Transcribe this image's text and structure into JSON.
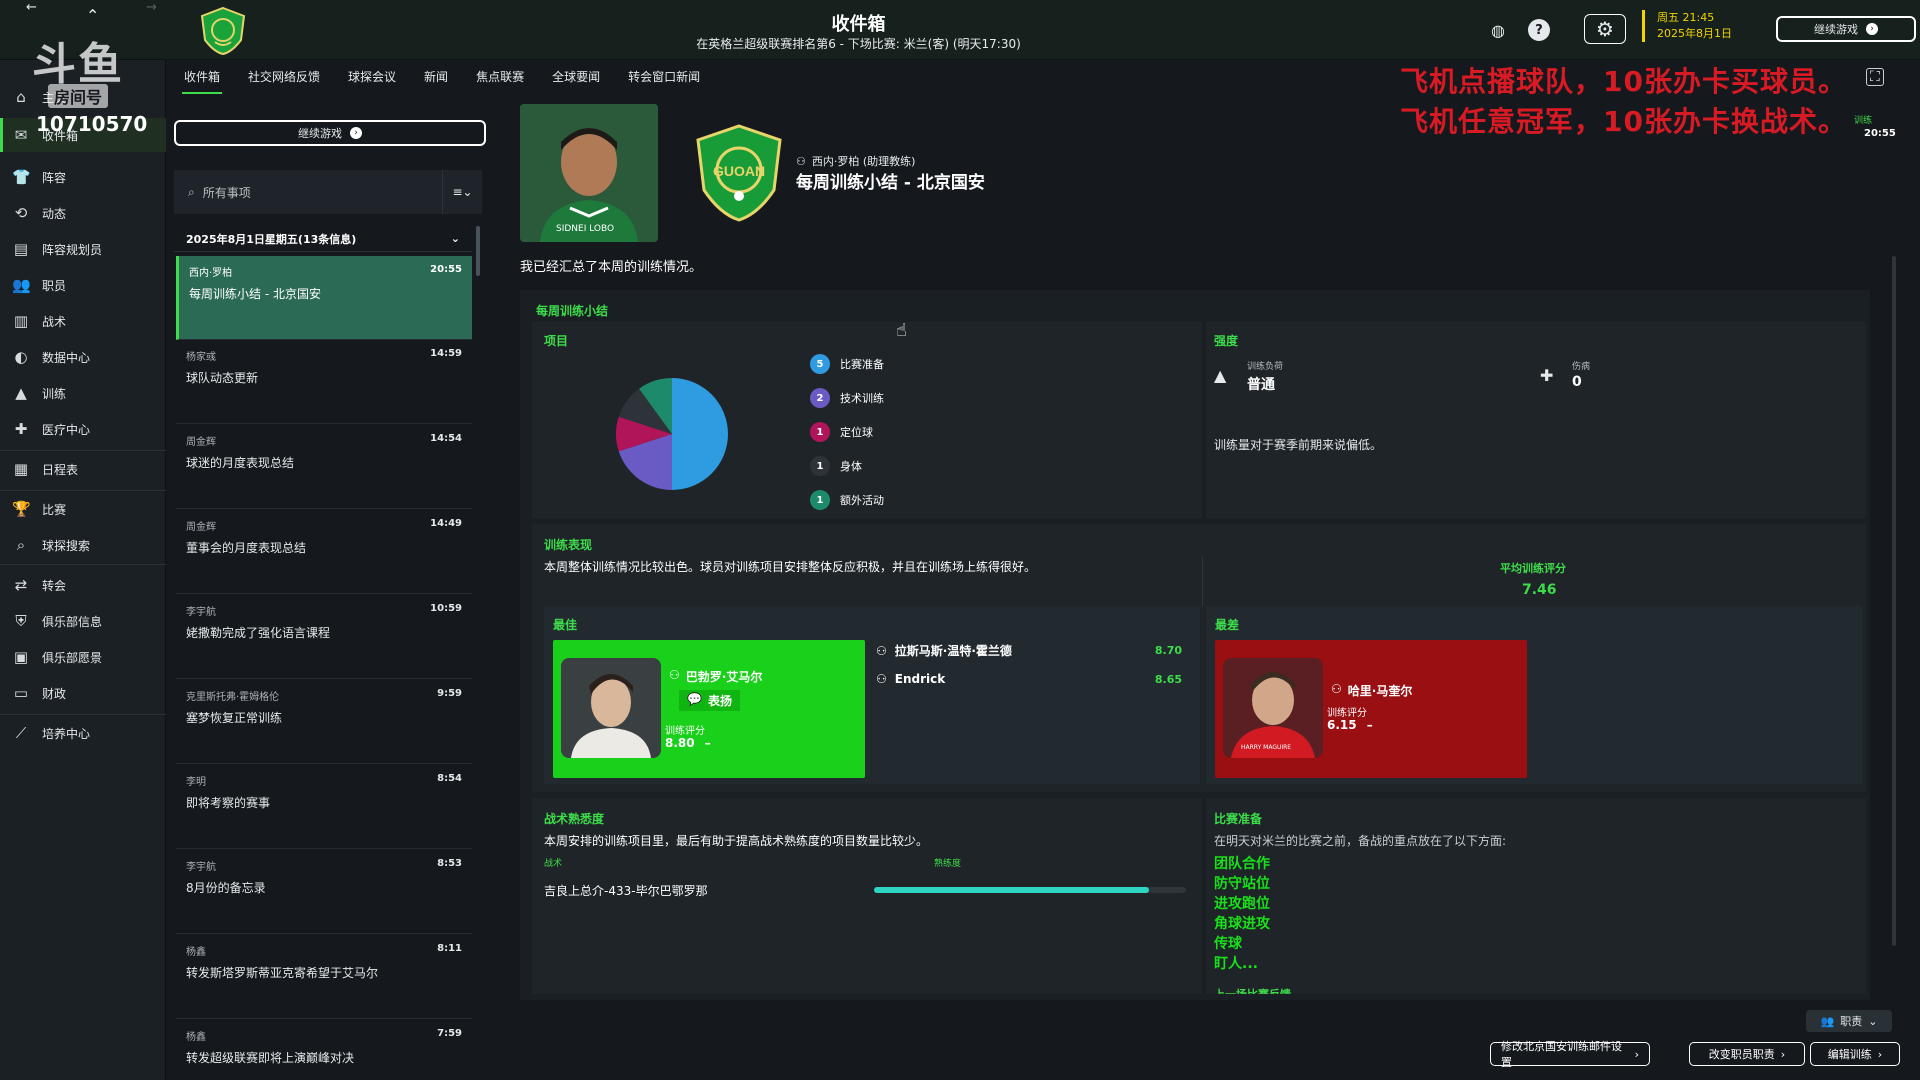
{
  "header": {
    "title": "收件箱",
    "subtitle": "在英格兰超级联赛排名第6 - 下场比赛: 米兰(客) (明天17:30)",
    "day_time": "周五 21:45",
    "date": "2025年8月1日",
    "continue_label": "继续游戏"
  },
  "watermark": {
    "logo_text": "斗鱼",
    "sub_text": "房间号",
    "room_id": "10710570"
  },
  "promo": {
    "line1": "飞机点播球队，10张办卡买球员。",
    "line2": "飞机任意冠军，10张办卡换战术。"
  },
  "tabs": [
    "收件箱",
    "社交网络反馈",
    "球探会议",
    "新闻",
    "焦点联赛",
    "全球要闻",
    "转会窗口新闻"
  ],
  "sidebar": {
    "items": [
      {
        "label": "主页",
        "icon": "home-icon"
      },
      {
        "label": "收件箱",
        "icon": "inbox-icon"
      },
      {
        "label": "阵容",
        "icon": "shirt-icon"
      },
      {
        "label": "动态",
        "icon": "dynamics-icon"
      },
      {
        "label": "阵容规划员",
        "icon": "clipboard-icon"
      },
      {
        "label": "职员",
        "icon": "staff-icon"
      },
      {
        "label": "战术",
        "icon": "tactics-icon"
      },
      {
        "label": "数据中心",
        "icon": "data-icon"
      },
      {
        "label": "训练",
        "icon": "cone-icon"
      },
      {
        "label": "医疗中心",
        "icon": "medical-icon"
      },
      {
        "label": "日程表",
        "icon": "calendar-icon"
      },
      {
        "label": "比赛",
        "icon": "trophy-icon"
      },
      {
        "label": "球探搜索",
        "icon": "search-icon"
      },
      {
        "label": "转会",
        "icon": "transfer-icon"
      },
      {
        "label": "俱乐部信息",
        "icon": "shield-icon"
      },
      {
        "label": "俱乐部愿景",
        "icon": "vision-icon"
      },
      {
        "label": "财政",
        "icon": "money-icon"
      },
      {
        "label": "培养中心",
        "icon": "development-icon"
      }
    ]
  },
  "inbox": {
    "continue_label": "继续游戏",
    "search_placeholder": "所有事项",
    "date_header": "2025年8月1日星期五(13条信息)",
    "messages": [
      {
        "sender": "西内·罗柏",
        "time": "20:55",
        "subject": "每周训练小结 - 北京国安"
      },
      {
        "sender": "杨家彧",
        "time": "14:59",
        "subject": "球队动态更新"
      },
      {
        "sender": "周金辉",
        "time": "14:54",
        "subject": "球迷的月度表现总结"
      },
      {
        "sender": "周金辉",
        "time": "14:49",
        "subject": "董事会的月度表现总结"
      },
      {
        "sender": "李宇航",
        "time": "10:59",
        "subject": "姥撒勒完成了强化语言课程"
      },
      {
        "sender": "克里斯托弗·霍姆格伦",
        "time": "9:59",
        "subject": "塞梦恢复正常训练"
      },
      {
        "sender": "李明",
        "time": "8:54",
        "subject": "即将考察的赛事"
      },
      {
        "sender": "李宇航",
        "time": "8:53",
        "subject": "8月份的备忘录"
      },
      {
        "sender": "杨鑫",
        "time": "8:11",
        "subject": "转发斯塔罗斯蒂亚克寄希望于艾马尔"
      },
      {
        "sender": "杨鑫",
        "time": "7:59",
        "subject": "转发超级联赛即将上演巅峰对决"
      }
    ]
  },
  "message": {
    "sender_line": "西内·罗柏 (助理教练)",
    "title": "每周训练小结 - 北京国安",
    "intro": "我已经汇总了本周的训练情况。",
    "photo_caption": "SIDNEI LOBO",
    "badge_text": "GUOAN"
  },
  "summary": {
    "section_title": "每周训练小结",
    "items_title": "项目",
    "items": [
      {
        "label": "比赛准备",
        "count": 5,
        "color": "#2f9be0"
      },
      {
        "label": "技术训练",
        "count": 2,
        "color": "#6a5bc4"
      },
      {
        "label": "定位球",
        "count": 1,
        "color": "#b0155a"
      },
      {
        "label": "身体",
        "count": 1,
        "color": "#2d3338"
      },
      {
        "label": "额外活动",
        "count": 1,
        "color": "#1e8a6c"
      }
    ],
    "intensity_title": "强度",
    "load_label": "训练负荷",
    "load_value": "普通",
    "injury_label": "伤病",
    "injury_value": "0",
    "intensity_note": "训练量对于赛季前期来说偏低。"
  },
  "performance": {
    "title": "训练表现",
    "text": "本周整体训练情况比较出色。球员对训练项目安排整体反应积极，并且在训练场上练得很好。",
    "avg_label": "平均训练评分",
    "avg_value": "7.46",
    "best_label": "最佳",
    "worst_label": "最差",
    "best_player": {
      "name": "巴勃罗·艾马尔",
      "tag": "表扬",
      "rating_label": "训练评分",
      "rating": "8.80",
      "trend": "–"
    },
    "runners": [
      {
        "name": "拉斯马斯·温特·霍兰德",
        "score": "8.70"
      },
      {
        "name": "Endrick",
        "score": "8.65"
      }
    ],
    "worst_player": {
      "name": "哈里·马奎尔",
      "rating_label": "训练评分",
      "rating": "6.15",
      "trend": "–",
      "shirt": "HARRY MAGUIRE"
    }
  },
  "tactical": {
    "title": "战术熟悉度",
    "text": "本周安排的训练项目里，最后有助于提高战术熟练度的项目数量比较少。",
    "col_tactic": "战术",
    "col_familiarity": "熟练度",
    "tactic_name": "吉良上总介-433-毕尔巴鄂罗那",
    "familiarity": 0.88
  },
  "prep": {
    "title": "比赛准备",
    "text": "在明天对米兰的比赛之前，备战的重点放在了以下方面:",
    "items": [
      "团队合作",
      "防守站位",
      "进攻跑位",
      "角球进攻",
      "传球",
      "盯人..."
    ],
    "cut_off": "上一场比赛反馈"
  },
  "bottom_buttons": {
    "role_label": "职责",
    "btn1": "修改北京国安训练邮件设置",
    "btn2": "改变职员职责",
    "btn3": "编辑训练"
  },
  "corner_clock": {
    "label": "训练",
    "time": "20:55"
  }
}
